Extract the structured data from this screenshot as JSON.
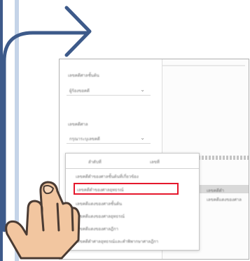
{
  "colors": {
    "connector": "#3d5a8a",
    "rail_light": "#c5d4e8",
    "highlight": "#e5172c",
    "skin": "#f2c6a0",
    "skin_outline": "#4a3b33"
  },
  "icons": [
    "right-arrow-icon",
    "pointing-hand-icon",
    "chevron-down-icon"
  ],
  "screenshot": {
    "field1": {
      "label": "เลขคดีศาลชั้นต้น",
      "value": "ผู้ร้องขอคดี"
    },
    "field2": {
      "label": "เลขคดีศาล",
      "value": "กรุณาระบุเลขคดี"
    },
    "menu": {
      "header": [
        "ลำดับที่",
        "เลขที่"
      ],
      "items": [
        "เลขคดีดำของศาลชั้นต้นที่เกี่ยวข้อง",
        "เลขคดีดำของศาลอุทธรณ์",
        "เลขคดีแดงของศาลชั้นต้น",
        "เลขคดีแดงของศาลอุทธรณ์",
        "เลขคดีแดงของศาลฎีกา",
        "เลขคดีดำศาลอุทธรณ์และคำพิพากษาศาลฎีกา"
      ],
      "highlighted_index": 1
    },
    "table": {
      "cell1": "เลขคดีดำ",
      "cell2": "เลขคดีแดงของศาล"
    }
  }
}
